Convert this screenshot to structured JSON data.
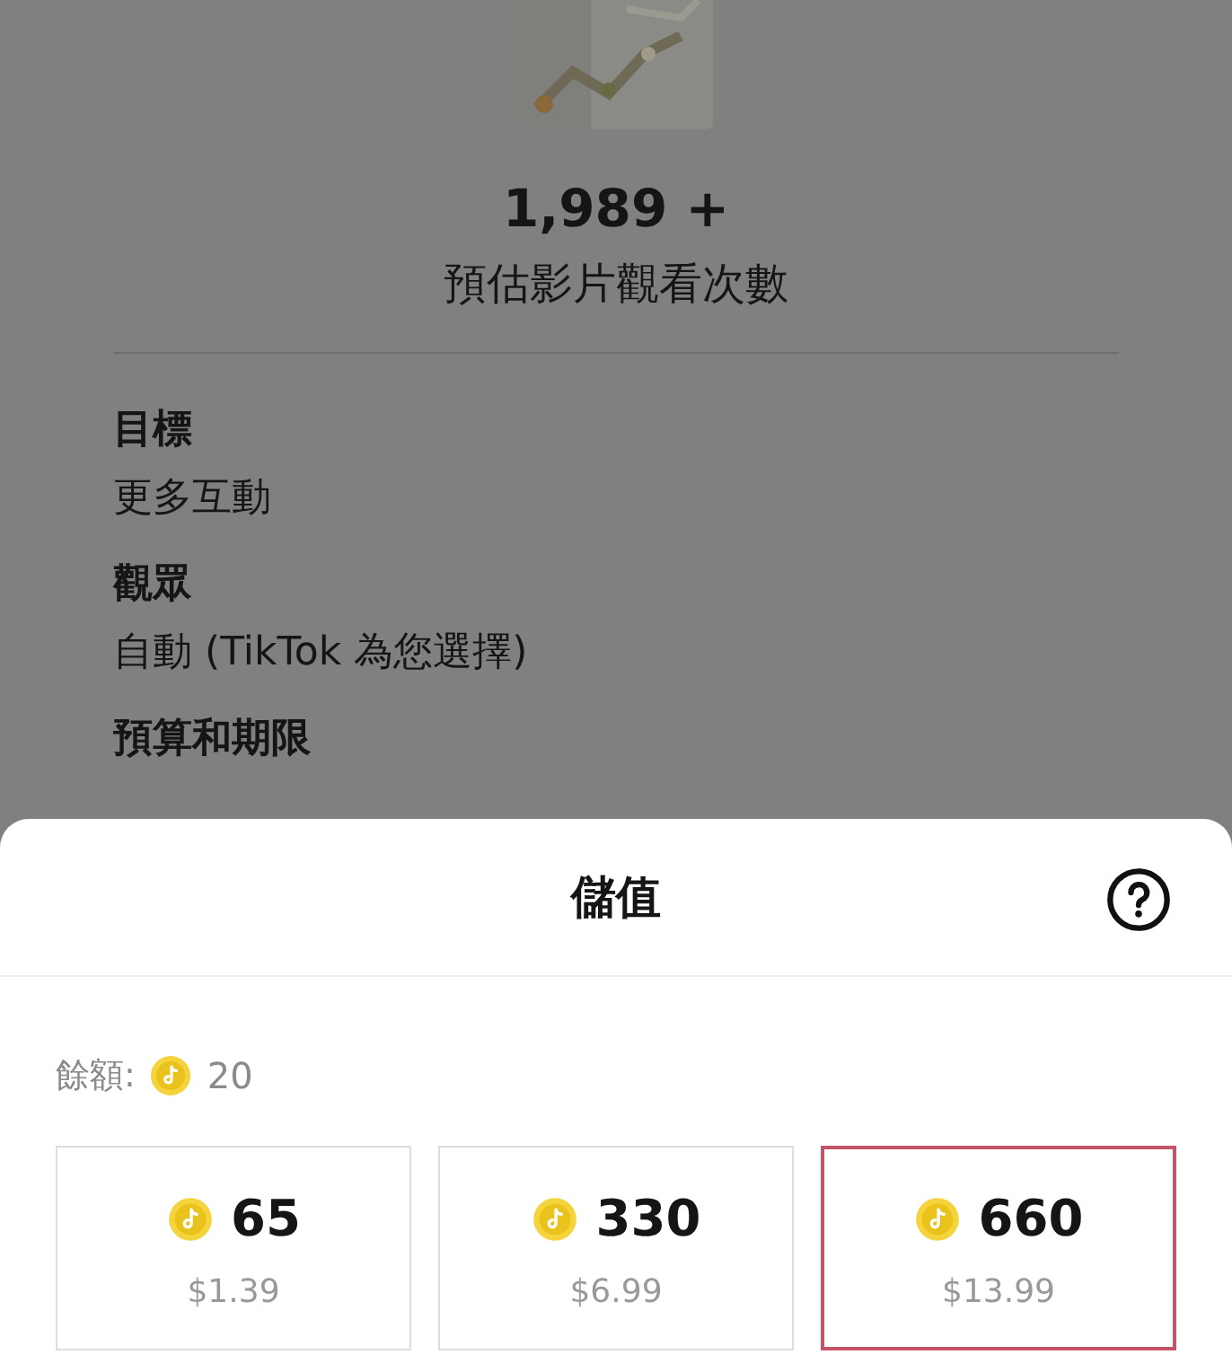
{
  "summary": {
    "views": "1,989 +",
    "views_label": "預估影片觀看次數"
  },
  "details": [
    {
      "heading": "目標",
      "value": "更多互動"
    },
    {
      "heading": "觀眾",
      "value": "自動 (TikTok 為您選擇)"
    },
    {
      "heading": "預算和期限"
    }
  ],
  "sheet": {
    "title": "儲值",
    "balance_label": "餘額:",
    "balance": "20",
    "packages": [
      {
        "coins": "65",
        "price": "$1.39",
        "selected": false
      },
      {
        "coins": "330",
        "price": "$6.99",
        "selected": false
      },
      {
        "coins": "660",
        "price": "$13.99",
        "selected": true
      }
    ]
  }
}
